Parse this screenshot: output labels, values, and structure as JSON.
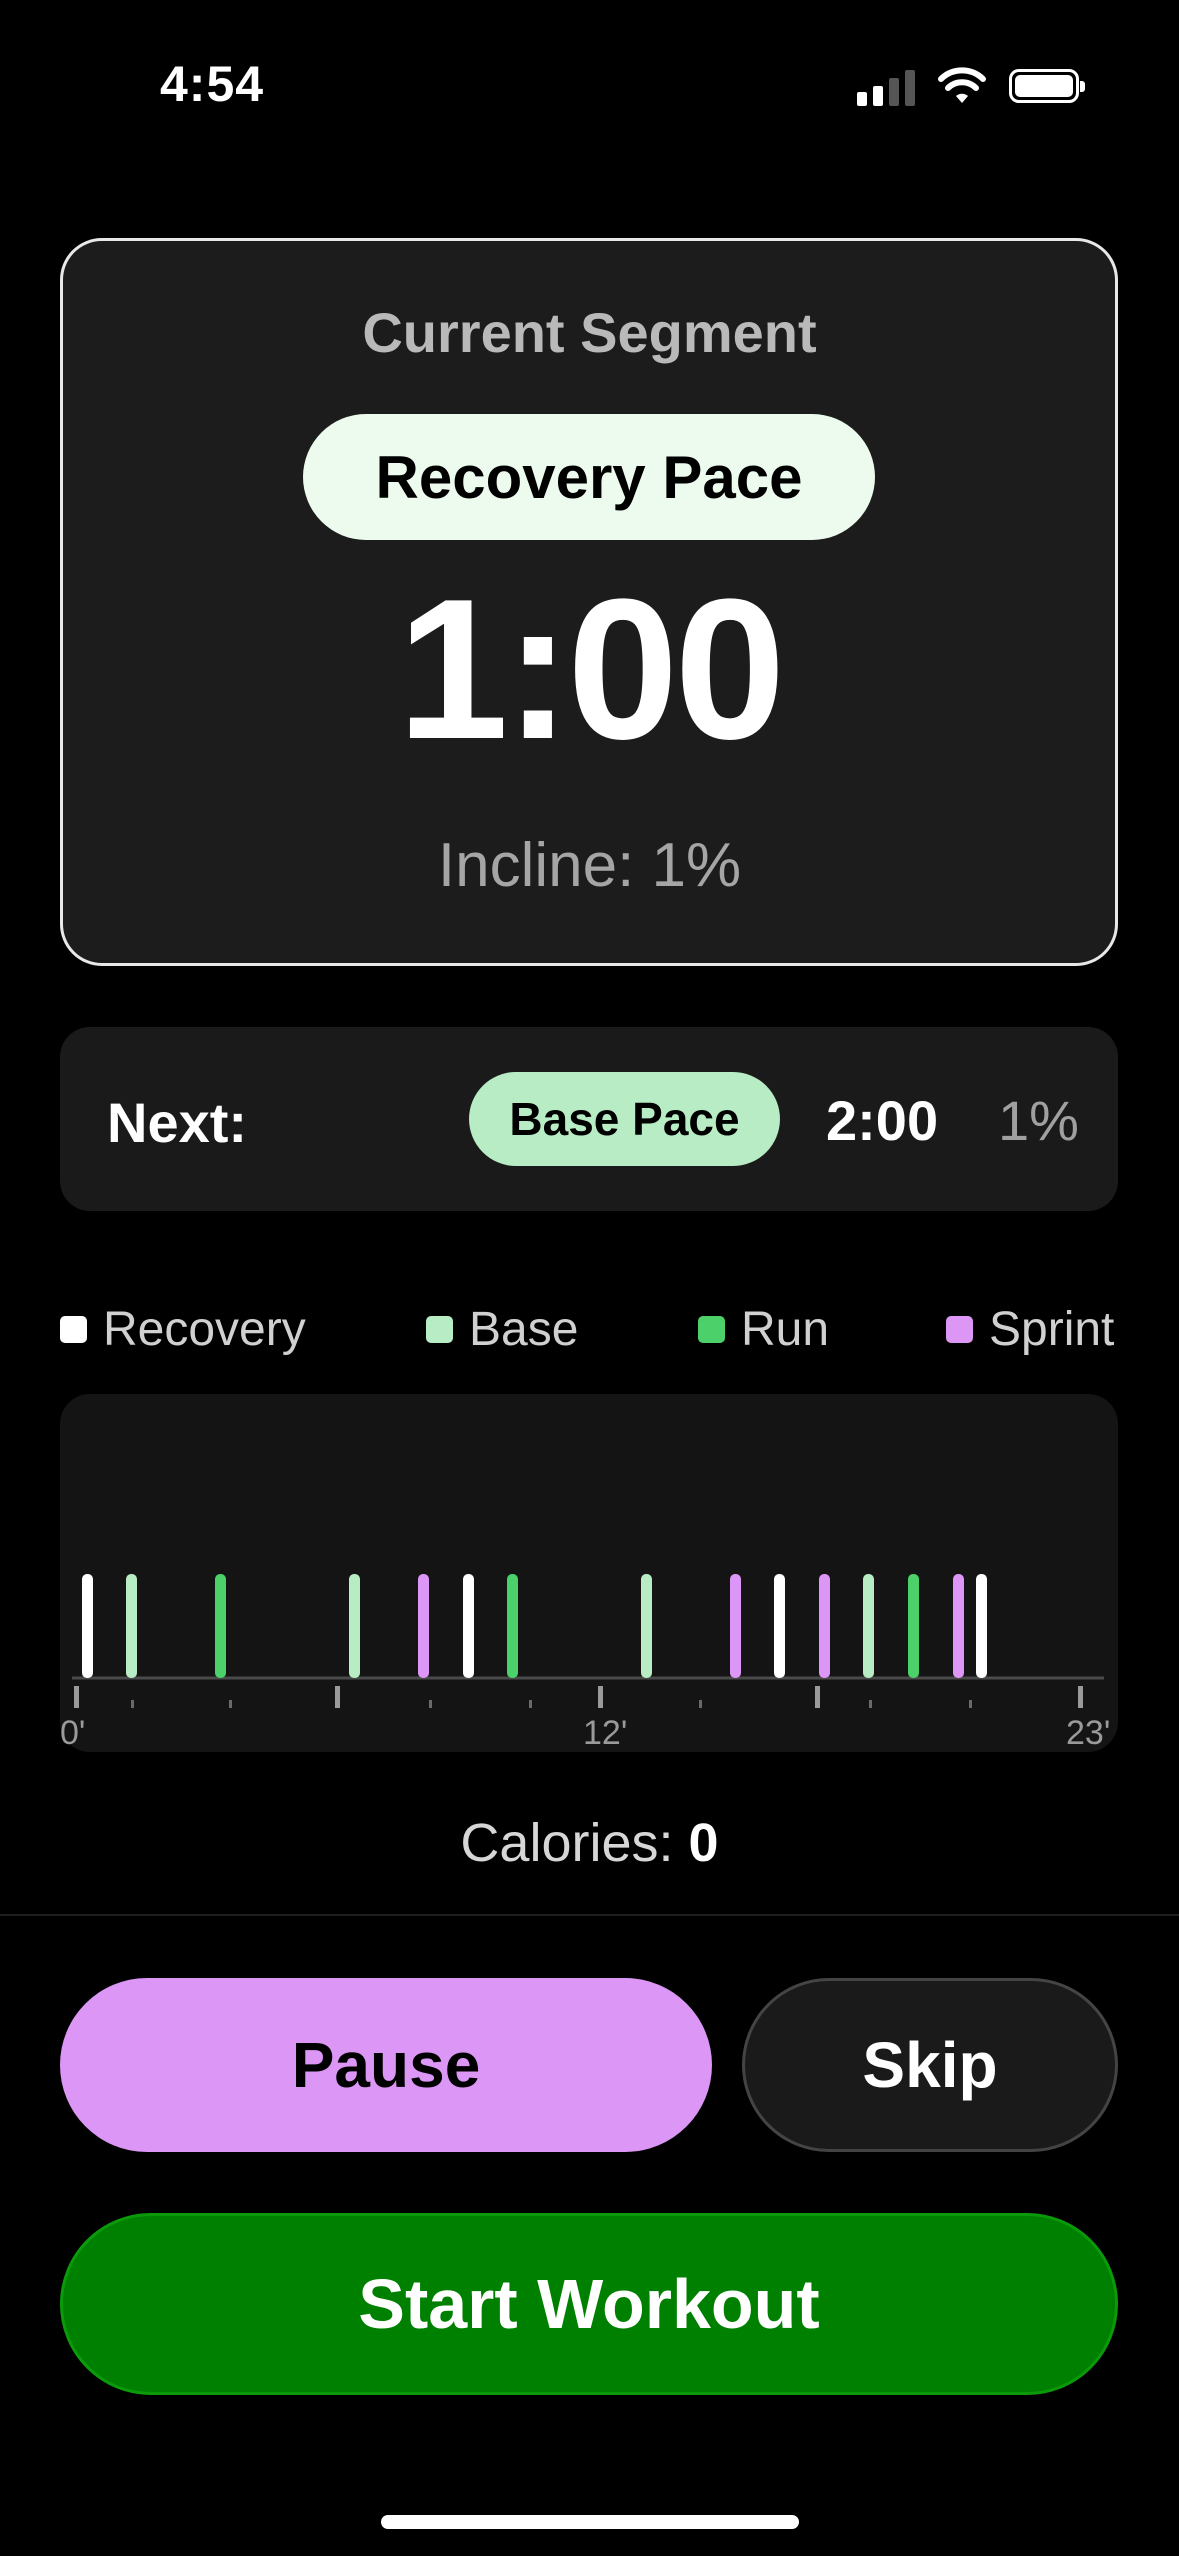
{
  "status_bar": {
    "time": "4:54",
    "icons": [
      "cellular-signal-icon",
      "wifi-icon",
      "battery-icon"
    ]
  },
  "current_segment": {
    "title": "Current Segment",
    "segment_name": "Recovery Pace",
    "time_remaining": "1:00",
    "incline": "Incline: 1%"
  },
  "next_segment": {
    "label": "Next:",
    "segment_name": "Base Pace",
    "duration": "2:00",
    "incline": "1%"
  },
  "legend": [
    {
      "label": "Recovery",
      "color": "#ffffff"
    },
    {
      "label": "Base",
      "color": "#b7ecc4"
    },
    {
      "label": "Run",
      "color": "#4cd16a"
    },
    {
      "label": "Sprint",
      "color": "#dc96f5"
    }
  ],
  "timeline": {
    "tick_labels": [
      "0'",
      "12'",
      "23'"
    ],
    "segments": [
      {
        "type": "Recovery"
      },
      {
        "type": "Base"
      },
      {
        "type": "Run"
      },
      {
        "type": "Base"
      },
      {
        "type": "Sprint"
      },
      {
        "type": "Recovery"
      },
      {
        "type": "Run"
      },
      {
        "type": "Base"
      },
      {
        "type": "Sprint"
      },
      {
        "type": "Recovery"
      },
      {
        "type": "Sprint"
      },
      {
        "type": "Base"
      },
      {
        "type": "Run"
      },
      {
        "type": "Sprint"
      },
      {
        "type": "Recovery"
      }
    ]
  },
  "calories": {
    "label": "Calories:",
    "value": "0"
  },
  "buttons": {
    "pause": "Pause",
    "skip": "Skip",
    "start": "Start Workout"
  },
  "colors": {
    "pause_button": "#dc96f5",
    "start_button": "#008000",
    "next_pill": "#b7ecc4",
    "current_pill": "#edfaee"
  }
}
